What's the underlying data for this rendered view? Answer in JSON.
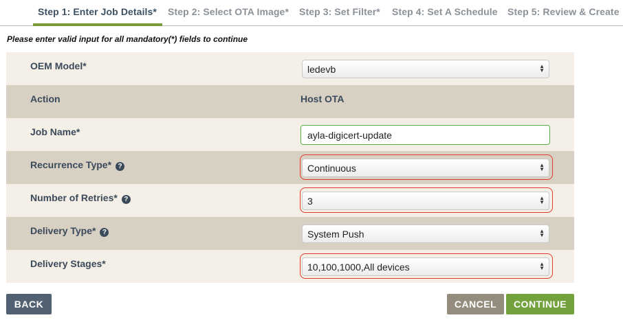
{
  "steps": [
    {
      "label": "Step 1: Enter Job Details*",
      "active": true
    },
    {
      "label": "Step 2: Select OTA Image*",
      "active": false
    },
    {
      "label": "Step 3: Set Filter*",
      "active": false
    },
    {
      "label": "Step 4: Set A Schedule",
      "active": false
    },
    {
      "label": "Step 5: Review & Create",
      "active": false
    }
  ],
  "notice": "Please enter valid input for all mandatory(*) fields to continue",
  "form": {
    "oem_model": {
      "label": "OEM Model*",
      "value": "ledevb"
    },
    "action": {
      "label": "Action",
      "value": "Host OTA"
    },
    "job_name": {
      "label": "Job Name*",
      "value": "ayla-digicert-update"
    },
    "recurrence_type": {
      "label": "Recurrence Type*",
      "value": "Continuous",
      "error": true
    },
    "number_of_retries": {
      "label": "Number of Retries*",
      "value": "3",
      "error": true
    },
    "delivery_type": {
      "label": "Delivery Type*",
      "value": "System Push"
    },
    "delivery_stages": {
      "label": "Delivery Stages*",
      "value": "10,100,1000,All devices",
      "error": true
    }
  },
  "help_icon_glyph": "?",
  "buttons": {
    "back": "BACK",
    "cancel": "CANCEL",
    "continue": "CONTINUE"
  },
  "colors": {
    "accent_green": "#73a13c",
    "error_red": "#e03b2c",
    "row_light": "#f4efe7",
    "row_dark": "#d7d0c3",
    "back_button": "#516171",
    "cancel_button": "#948c7c"
  }
}
